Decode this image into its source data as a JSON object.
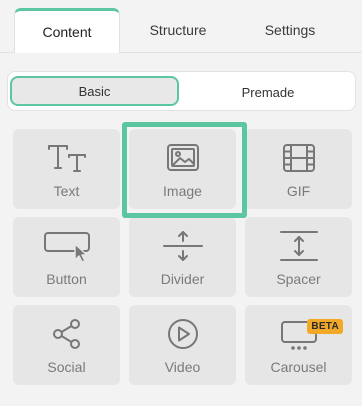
{
  "tabs": [
    {
      "label": "Content"
    },
    {
      "label": "Structure"
    },
    {
      "label": "Settings"
    }
  ],
  "segment": {
    "basic": "Basic",
    "premade": "Premade",
    "selected": "Basic"
  },
  "blocks": [
    {
      "label": "Text",
      "icon": "text-icon"
    },
    {
      "label": "Image",
      "icon": "image-icon"
    },
    {
      "label": "GIF",
      "icon": "gif-film-icon"
    },
    {
      "label": "Button",
      "icon": "button-cursor-icon"
    },
    {
      "label": "Divider",
      "icon": "divider-icon"
    },
    {
      "label": "Spacer",
      "icon": "spacer-icon"
    },
    {
      "label": "Social",
      "icon": "share-icon"
    },
    {
      "label": "Video",
      "icon": "play-icon"
    },
    {
      "label": "Carousel",
      "icon": "carousel-icon",
      "badge": "BETA"
    }
  ],
  "selected_block": "Image",
  "colors": {
    "accent": "#5cc6a0",
    "badge": "#f2a928",
    "block_bg": "#e6e6e6",
    "icon": "#777777"
  }
}
